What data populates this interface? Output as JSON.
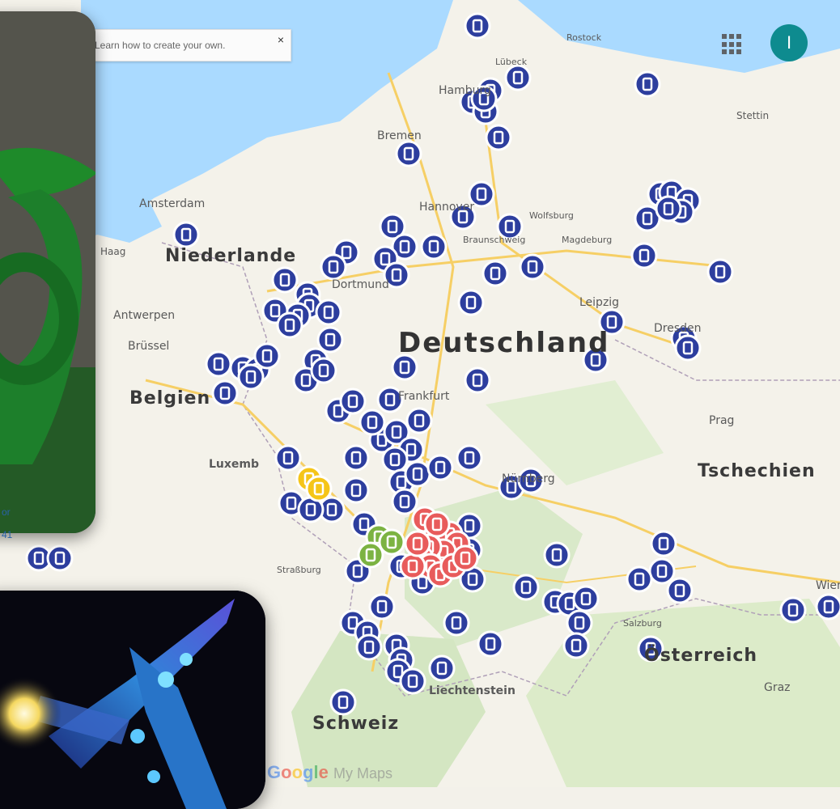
{
  "notice": {
    "text": "Learn how to create your own.",
    "close": "×"
  },
  "account": {
    "avatar_letter": "I"
  },
  "labels": {
    "countries": [
      "Deutschland",
      "Niederlande",
      "Belgien",
      "Tschechien",
      "Österreich",
      "Schweiz",
      "Liechtenstein",
      "Luxemb"
    ],
    "cities": [
      "Rostock",
      "Lübeck",
      "Hamburg",
      "Bremen",
      "Stettin",
      "Amsterdam",
      "Haag",
      "Hannover",
      "Wolfsburg",
      "Braunschweig",
      "Magdeburg",
      "Antwerpen",
      "Brüssel",
      "Dortmund",
      "Leipzig",
      "Dresden",
      "Frankfurt",
      "Prag",
      "Nürnberg",
      "Straßburg",
      "Salzburg",
      "Graz",
      "Wien"
    ]
  },
  "branding": {
    "google": "Google",
    "suffix": "My Maps"
  },
  "attribution": [
    "or",
    "41"
  ],
  "markers": {
    "blue_count": 115,
    "red_count": 14,
    "green_count": 3,
    "yellow_count": 2,
    "colors": {
      "blue": "#2d3e9e",
      "red": "#e85b5b",
      "green": "#7cb342",
      "yellow": "#f5c518"
    }
  }
}
